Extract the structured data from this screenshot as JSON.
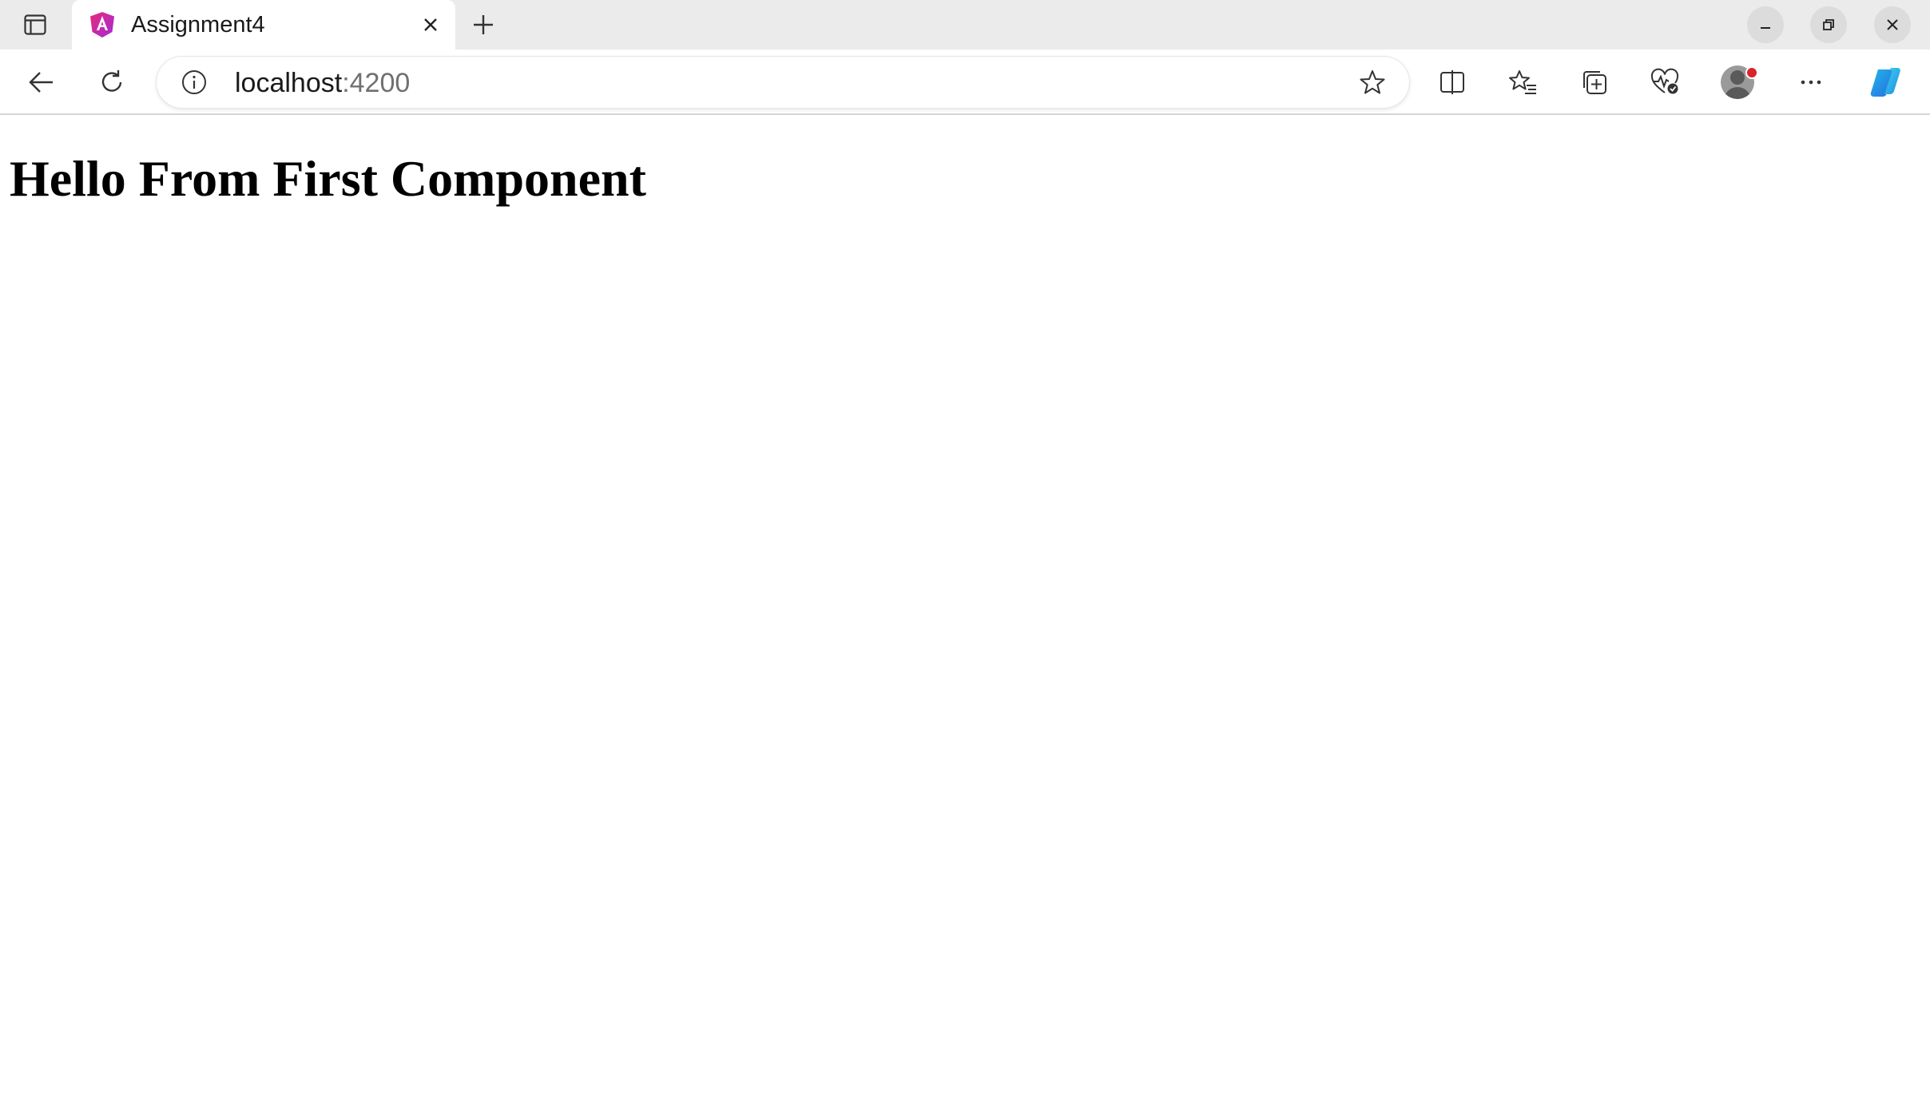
{
  "browser": {
    "tab": {
      "title": "Assignment4",
      "favicon": "angular-icon"
    },
    "address_bar": {
      "host": "localhost",
      "port": ":4200"
    },
    "icons": {
      "tab_actions": "tab-actions-icon",
      "close_tab": "close-icon",
      "new_tab": "plus-icon",
      "minimize": "minimize-icon",
      "restore": "restore-icon",
      "close_window": "close-icon",
      "back": "arrow-left-icon",
      "reload": "reload-icon",
      "site_info": "info-icon",
      "favorite": "star-icon",
      "split_screen": "split-screen-icon",
      "favorites": "favorites-icon",
      "collections": "collections-icon",
      "browser_essentials": "heart-pulse-icon",
      "profile": "avatar",
      "more": "more-icon",
      "copilot": "copilot-icon"
    },
    "colors": {
      "tab_strip_bg": "#ebebeb",
      "notification_dot": "#d9242b",
      "angular_pink": "#e7297a",
      "angular_purple": "#a52bd6"
    }
  },
  "page": {
    "heading": "Hello From First Component"
  }
}
